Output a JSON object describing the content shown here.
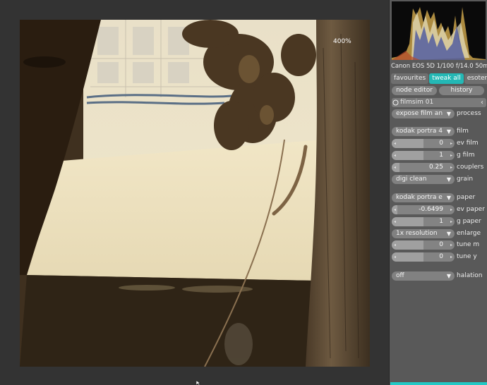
{
  "viewport": {
    "zoom_label": "400%"
  },
  "panel": {
    "camera_info": "Canon EOS 5D 1/100 f/14.0 50m",
    "tabs": [
      {
        "label": "favourites",
        "active": false
      },
      {
        "label": "tweak all",
        "active": true
      },
      {
        "label": "esoteric",
        "active": false
      }
    ],
    "buttons": {
      "node_editor": "node editor",
      "history": "history"
    },
    "module": {
      "name": "filmsim 01",
      "collapse_icon": "chevron-left-icon"
    },
    "params": {
      "process": {
        "value": "expose film an",
        "label": "process"
      },
      "film": {
        "value": "kodak portra 4",
        "label": "film"
      },
      "ev_film": {
        "value": "0",
        "label": "ev film",
        "fill_fraction": 0.5
      },
      "g_film": {
        "value": "1",
        "label": "g film",
        "fill_fraction": 0.5
      },
      "couplers": {
        "value": "0.25",
        "label": "couplers",
        "fill_fraction": 0.12
      },
      "grain": {
        "value": "digi clean",
        "label": "grain"
      },
      "paper": {
        "value": "kodak portra e",
        "label": "paper"
      },
      "ev_paper": {
        "value": "-0.6499",
        "label": "ev paper",
        "fill_fraction": 0.09
      },
      "g_paper": {
        "value": "1",
        "label": "g paper",
        "fill_fraction": 0.5
      },
      "enlarge": {
        "value": "1x resolution",
        "label": "enlarge"
      },
      "tune_m": {
        "value": "0",
        "label": "tune m",
        "fill_fraction": 0.5
      },
      "tune_y": {
        "value": "0",
        "label": "tune y",
        "fill_fraction": 0.5
      },
      "halation": {
        "value": "off",
        "label": "halation"
      }
    }
  },
  "colors": {
    "accent": "#24b8b5",
    "panel_bg": "#595959",
    "widget_bg": "#818181",
    "app_bg": "#333333"
  }
}
